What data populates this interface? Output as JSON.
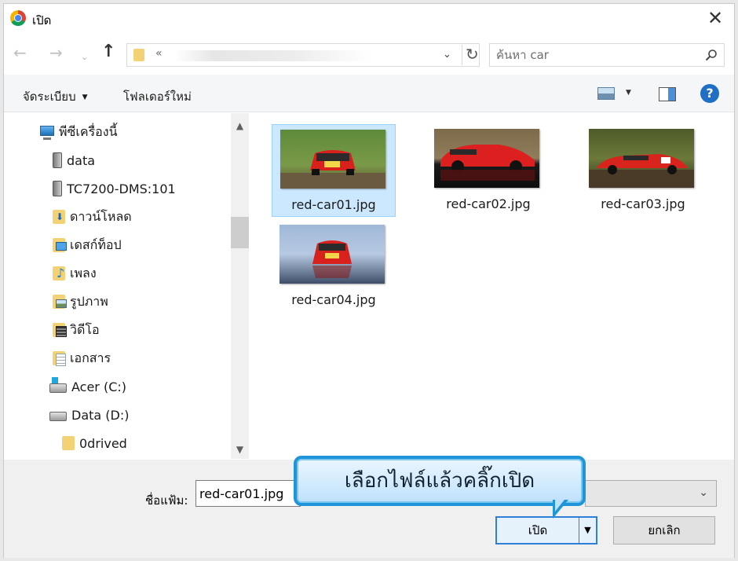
{
  "window": {
    "title": "เปิด",
    "close_symbol": "✕",
    "app_icon": "chrome-logo-icon"
  },
  "navigation": {
    "back_symbol": "←",
    "forward_symbol": "→",
    "recent_symbol": "⌄",
    "up_symbol": "↑",
    "address_prefix": "«",
    "dropdown_symbol": "⌄",
    "refresh_symbol": "↻",
    "search_placeholder": "ค้นหา car"
  },
  "toolbar": {
    "organize_label": "จัดระเบียบ",
    "organize_caret": "▼",
    "new_folder_label": "โฟลเดอร์ใหม่",
    "view_caret": "▼",
    "help_label": "?"
  },
  "sidebar": {
    "items": [
      {
        "label": "พีซีเครื่องนี้",
        "icon": "computer-icon"
      },
      {
        "label": "data",
        "icon": "network-drive-icon"
      },
      {
        "label": "TC7200-DMS:101",
        "icon": "network-drive-icon"
      },
      {
        "label": "ดาวน์โหลด",
        "icon": "downloads-folder-icon"
      },
      {
        "label": "เดสก์ท็อป",
        "icon": "desktop-folder-icon"
      },
      {
        "label": "เพลง",
        "icon": "music-folder-icon"
      },
      {
        "label": "รูปภาพ",
        "icon": "pictures-folder-icon"
      },
      {
        "label": "วิดีโอ",
        "icon": "videos-folder-icon"
      },
      {
        "label": "เอกสาร",
        "icon": "documents-folder-icon"
      },
      {
        "label": "Acer (C:)",
        "icon": "system-drive-icon"
      },
      {
        "label": "Data (D:)",
        "icon": "hard-drive-icon"
      },
      {
        "label": "0drived",
        "icon": "folder-icon"
      }
    ],
    "scroll_up_symbol": "▲",
    "scroll_down_symbol": "▼"
  },
  "files": [
    {
      "name": "red-car01.jpg",
      "selected": true
    },
    {
      "name": "red-car02.jpg",
      "selected": false
    },
    {
      "name": "red-car03.jpg",
      "selected": false
    },
    {
      "name": "red-car04.jpg",
      "selected": false
    }
  ],
  "footer": {
    "filename_label": "ชื่อแฟ้ม:",
    "filename_value": "red-car01.jpg",
    "filter_chevron": "⌄",
    "open_label": "เปิด",
    "open_split_symbol": "▼",
    "cancel_label": "ยกเลิก"
  },
  "callout": {
    "text": "เลือกไฟล์แล้วคลิ๊กเปิด"
  },
  "colors": {
    "selection_bg": "#cce8ff",
    "selection_border": "#99d1ff",
    "callout_border": "#1e95d8",
    "default_button_border": "#2f7fd6"
  }
}
